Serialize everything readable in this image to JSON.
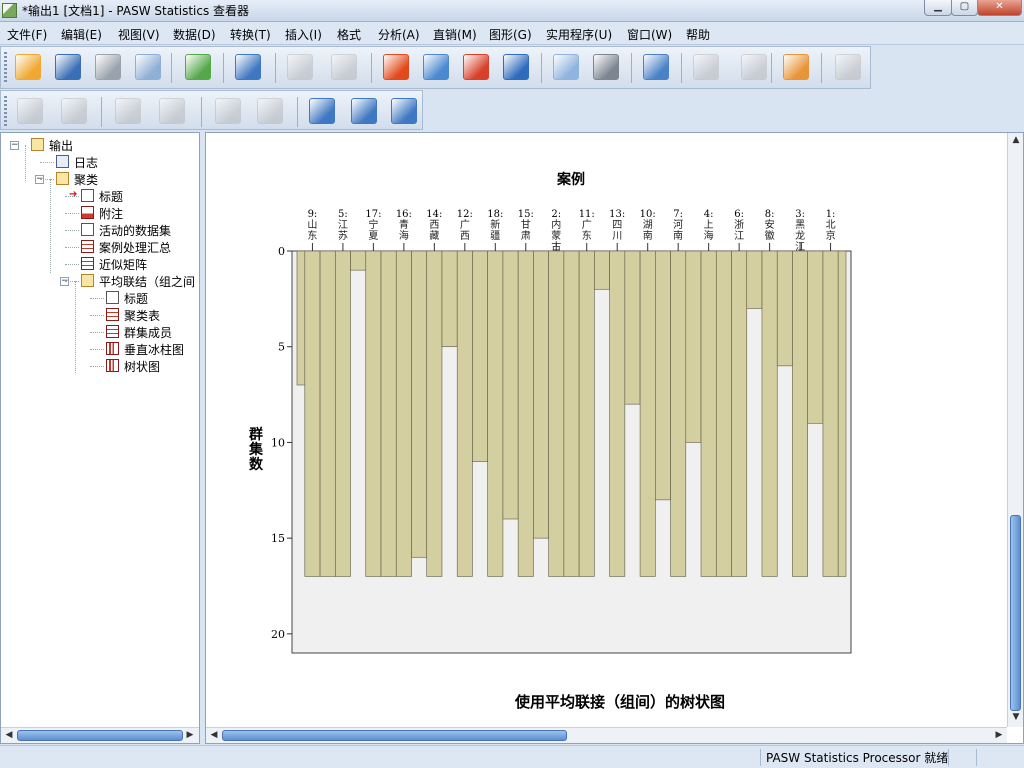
{
  "window": {
    "title": "*输出1 [文档1] - PASW Statistics 查看器",
    "min_glyph": "▁",
    "max_glyph": "▢",
    "close_glyph": "✕"
  },
  "menu": [
    "文件(F)",
    "编辑(E)",
    "视图(V)",
    "数据(D)",
    "转换(T)",
    "插入(I)",
    "格式",
    "分析(A)",
    "直销(M)",
    "图形(G)",
    "实用程序(U)",
    "窗口(W)",
    "帮助"
  ],
  "toolbar1": [
    {
      "icon": "open-folder-icon",
      "color": "#f0a830"
    },
    {
      "icon": "save-icon",
      "color": "#3a6fb5"
    },
    {
      "icon": "print-icon",
      "color": "#9aa3ad"
    },
    {
      "icon": "print-preview-icon",
      "color": "#8fb0d6"
    },
    {
      "icon": "export-icon",
      "color": "#55a84a"
    },
    {
      "icon": "recall-dialog-icon",
      "color": "#3f78c2"
    },
    {
      "icon": "undo-icon",
      "color": "#a9b2bd",
      "disabled": true
    },
    {
      "icon": "redo-icon",
      "color": "#a9b2bd",
      "disabled": true
    },
    {
      "icon": "goto-data-icon",
      "color": "#e24a1c"
    },
    {
      "icon": "goto-case-icon",
      "color": "#4a88cf"
    },
    {
      "icon": "goto-variable-icon",
      "color": "#d8402a"
    },
    {
      "icon": "variables-icon",
      "color": "#2f6bbd"
    },
    {
      "icon": "use-variable-sets-icon",
      "color": "#8fb4de"
    },
    {
      "icon": "show-all-variables-icon",
      "color": "#7c8590"
    },
    {
      "icon": "spelling-icon",
      "color": "#4b82c6"
    },
    {
      "icon": "designate-window-icon",
      "color": "#a9b2bd",
      "disabled": true
    },
    {
      "icon": "select-last-output-icon",
      "color": "#a9b2bd",
      "disabled": true
    },
    {
      "icon": "create-edit-script-icon",
      "color": "#e8953a"
    },
    {
      "icon": "run-script-icon",
      "color": "#a9b2bd",
      "disabled": true
    }
  ],
  "toolbar2": [
    {
      "icon": "promote-icon",
      "color": "#a9b2bd",
      "disabled": true
    },
    {
      "icon": "demote-icon",
      "color": "#a9b2bd",
      "disabled": true
    },
    {
      "icon": "expand-icon",
      "color": "#a9b2bd",
      "disabled": true
    },
    {
      "icon": "collapse-icon",
      "color": "#a9b2bd",
      "disabled": true
    },
    {
      "icon": "show-icon",
      "color": "#a9b2bd",
      "disabled": true
    },
    {
      "icon": "hide-icon",
      "color": "#a9b2bd",
      "disabled": true
    },
    {
      "icon": "insert-heading-icon",
      "color": "#3f78c2"
    },
    {
      "icon": "insert-title-icon",
      "color": "#3f78c2"
    },
    {
      "icon": "insert-text-icon",
      "color": "#3f78c2"
    }
  ],
  "outline": [
    {
      "label": "输出",
      "icon": "folder-icon",
      "level": 0,
      "expander": "−"
    },
    {
      "label": "日志",
      "icon": "log-icon",
      "level": 1
    },
    {
      "label": "聚类",
      "icon": "folder-icon",
      "level": 1,
      "expander": "−"
    },
    {
      "label": "标题",
      "icon": "title-icon",
      "level": 2,
      "current": true
    },
    {
      "label": "附注",
      "icon": "note-icon",
      "level": 2
    },
    {
      "label": "活动的数据集",
      "icon": "text-icon",
      "level": 2
    },
    {
      "label": "案例处理汇总",
      "icon": "table-icon",
      "level": 2
    },
    {
      "label": "近似矩阵",
      "icon": "table-icon",
      "level": 2
    },
    {
      "label": "平均联结（组之间",
      "icon": "folder-icon",
      "level": 2,
      "expander": "−"
    },
    {
      "label": "标题",
      "icon": "title-icon",
      "level": 3
    },
    {
      "label": "聚类表",
      "icon": "table-icon",
      "level": 3
    },
    {
      "label": "群集成员",
      "icon": "table-icon",
      "level": 3
    },
    {
      "label": "垂直冰柱图",
      "icon": "chart-icon",
      "level": 3
    },
    {
      "label": "树状图",
      "icon": "chart-icon",
      "level": 3
    }
  ],
  "scrollbars": {
    "left_arrow": "◀",
    "right_arrow": "▶",
    "up_arrow": "▲",
    "down_arrow": "▼"
  },
  "status": {
    "text": "PASW Statistics Processor 就绪"
  },
  "chart_data": {
    "type": "bar",
    "subtype": "vertical-icicle",
    "title": "案例",
    "ylabel": "群集数",
    "ylim": [
      0,
      21
    ],
    "yticks": [
      0,
      5,
      10,
      15,
      20
    ],
    "caption": "使用平均联接（组间）的树状图",
    "cases": [
      {
        "number": "9:",
        "name": "山东"
      },
      {
        "number": "5:",
        "name": "江苏"
      },
      {
        "number": "17:",
        "name": "宁夏"
      },
      {
        "number": "16:",
        "name": "青海"
      },
      {
        "number": "14:",
        "name": "西藏"
      },
      {
        "number": "12:",
        "name": "广西"
      },
      {
        "number": "18:",
        "name": "新疆"
      },
      {
        "number": "15:",
        "name": "甘肃"
      },
      {
        "number": "2:",
        "name": "内蒙古"
      },
      {
        "number": "11:",
        "name": "广东"
      },
      {
        "number": "13:",
        "name": "四川"
      },
      {
        "number": "10:",
        "name": "湖南"
      },
      {
        "number": "7:",
        "name": "河南"
      },
      {
        "number": "4:",
        "name": "上海"
      },
      {
        "number": "6:",
        "name": "浙江"
      },
      {
        "number": "8:",
        "name": "安徽"
      },
      {
        "number": "3:",
        "name": "黑龙江"
      },
      {
        "number": "1:",
        "name": "北京"
      }
    ],
    "case_bar_extent": 17,
    "gap_extents": [
      7,
      17,
      1,
      17,
      16,
      5,
      11,
      14,
      15,
      17,
      2,
      8,
      13,
      10,
      17,
      3,
      6,
      9,
      12,
      17,
      4,
      17
    ],
    "colors": {
      "bar": "#d3cfa1",
      "bar_edge": "#5d5a41",
      "plot_bg": "#f0f0f0",
      "gap_bg": "#ffffff"
    }
  }
}
